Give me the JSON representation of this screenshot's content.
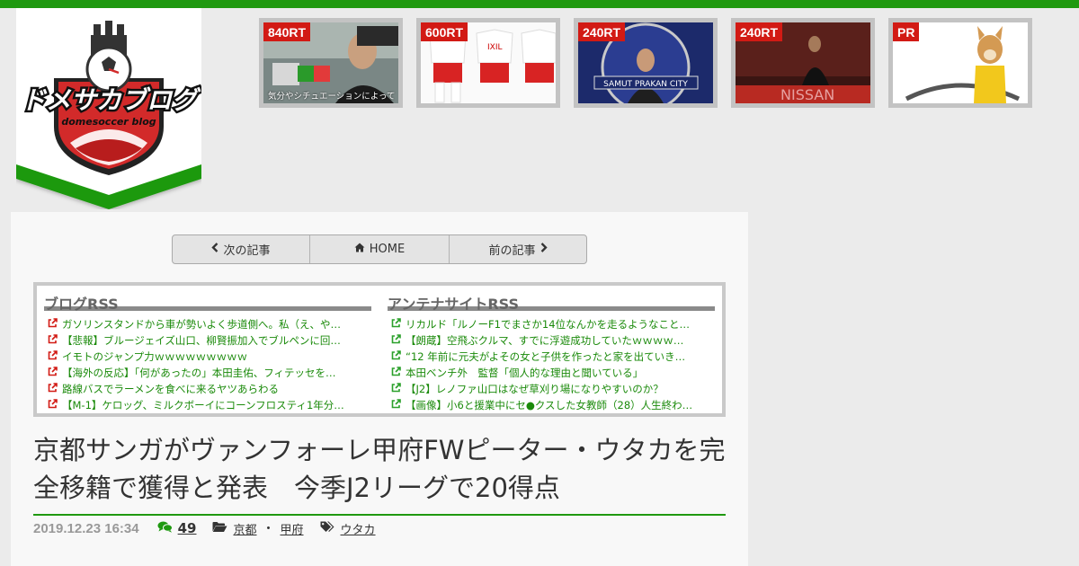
{
  "site": {
    "logo_text": "ドメサカブログ",
    "logo_subtext": "domesoccer blog"
  },
  "thumbs": [
    {
      "badge": "840RT",
      "caption": "気分やシチュエーションによって"
    },
    {
      "badge": "600RT",
      "caption": ""
    },
    {
      "badge": "240RT",
      "caption": ""
    },
    {
      "badge": "240RT",
      "caption": ""
    },
    {
      "badge": "PR",
      "caption": ""
    }
  ],
  "pager": {
    "next": "次の記事",
    "home": "HOME",
    "prev": "前の記事"
  },
  "rss": {
    "blog": {
      "title": "ブログRSS",
      "items": [
        "ガソリンスタンドから車が勢いよく歩道側へ。私（え、や…",
        "【悲報】ブルージェイズ山口、柳賢振加入でブルペンに回…",
        "イモトのジャンプ力ｗｗｗｗｗｗｗｗｗ",
        "【海外の反応】「何があったの」本田圭佑、フィテッセを…",
        "路線バスでラーメンを食べに来るヤツあらわる",
        "【M-1】ケロッグ、ミルクボーイにコーンフロスティ1年分…"
      ]
    },
    "antenna": {
      "title": "アンテナサイトRSS",
      "items": [
        "リカルド「ルノーF1でまさか14位なんかを走るようなこと…",
        "【朗蔵】空飛ぶクルマ、すでに浮遊成功していたｗｗｗｗ…",
        "“12 年前に元夫がよその女と子供を作ったと家を出ていき…",
        "本田ベンチ外　監督「個人的な理由と聞いている」",
        "【J2】レノファ山口はなぜ草刈り場になりやすいのか？",
        "【画像】小6と援業中にセ●クスした女教師（28）人生終わ…"
      ]
    }
  },
  "article": {
    "title": "京都サンガがヴァンフォーレ甲府FWピーター・ウタカを完全移籍で獲得と発表　今季J2リーグで20得点",
    "date": "2019.12.23 16:34",
    "comment_count": "49",
    "categories": [
      "京都",
      "甲府"
    ],
    "category_separator": "・",
    "tags": [
      "ウタカ"
    ]
  },
  "colors": {
    "accent": "#1f9910",
    "badge": "#d21a14",
    "link": "#1a8a0a"
  }
}
